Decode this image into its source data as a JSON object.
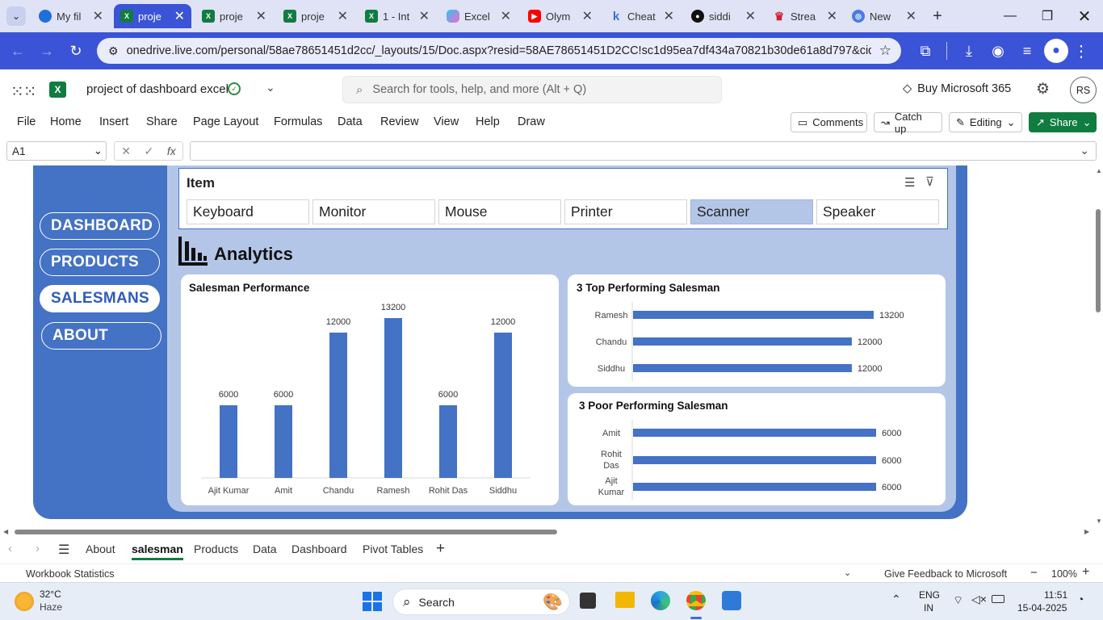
{
  "browser": {
    "tabs": [
      {
        "label": "My fil",
        "icon": "onedrive-icon",
        "active": false
      },
      {
        "label": "proje",
        "icon": "excel-icon",
        "active": true
      },
      {
        "label": "proje",
        "icon": "excel-icon",
        "active": false
      },
      {
        "label": "proje",
        "icon": "excel-icon",
        "active": false
      },
      {
        "label": "1 - Int",
        "icon": "excel-icon",
        "active": false
      },
      {
        "label": "Excel",
        "icon": "copilot-icon",
        "active": false
      },
      {
        "label": "Olym",
        "icon": "youtube-icon",
        "active": false
      },
      {
        "label": "Cheat",
        "icon": "k-icon",
        "active": false
      },
      {
        "label": "siddi",
        "icon": "github-icon",
        "active": false
      },
      {
        "label": "Strea",
        "icon": "utorrent-icon",
        "active": false
      },
      {
        "label": "New",
        "icon": "chrome-icon",
        "active": false
      }
    ],
    "url": "onedrive.live.com/personal/58ae78651451d2cc/_layouts/15/Doc.aspx?resid=58AE78651451D2CC!sc1d95ea7df434a70821b30de61a8d797&cid=58..."
  },
  "excel": {
    "doc_title": "project of dashboard excel",
    "search_placeholder": "Search for tools, help, and more (Alt + Q)",
    "buy_label": "Buy Microsoft 365",
    "avatar": "RS",
    "menus": [
      "File",
      "Home",
      "Insert",
      "Share",
      "Page Layout",
      "Formulas",
      "Data",
      "Review",
      "View",
      "Help",
      "Draw"
    ],
    "comments_label": "Comments",
    "catchup_label": "Catch up",
    "editing_label": "Editing",
    "share_label": "Share",
    "name_box": "A1",
    "fx": "fx"
  },
  "dashboard": {
    "nav": [
      "DASHBOARD",
      "PRODUCTS",
      "SALESMANS",
      "ABOUT"
    ],
    "nav_selected": 2,
    "slicer_title": "Item",
    "slicer_items": [
      "Keyboard",
      "Monitor",
      "Mouse",
      "Printer",
      "Scanner",
      "Speaker"
    ],
    "slicer_selected": 4,
    "analytics_title": "Analytics"
  },
  "chart_data": [
    {
      "type": "bar",
      "title": "Salesman Performance",
      "categories": [
        "Ajit Kumar",
        "Amit",
        "Chandu",
        "Ramesh",
        "Rohit Das",
        "Siddhu"
      ],
      "values": [
        6000,
        6000,
        12000,
        13200,
        6000,
        12000
      ],
      "ylim": [
        0,
        14000
      ],
      "color": "#4472c4"
    },
    {
      "type": "bar",
      "orientation": "horizontal",
      "title": "3 Top Performing Salesman",
      "categories": [
        "Ramesh",
        "Chandu",
        "Siddhu"
      ],
      "values": [
        13200,
        12000,
        12000
      ],
      "xlim": [
        0,
        13200
      ],
      "color": "#4472c4"
    },
    {
      "type": "bar",
      "orientation": "horizontal",
      "title": "3 Poor Performing Salesman",
      "categories": [
        "Amit",
        "Rohit Das",
        "Ajit Kumar"
      ],
      "values": [
        6000,
        6000,
        6000
      ],
      "xlim": [
        0,
        6000
      ],
      "color": "#4472c4"
    }
  ],
  "sheets": {
    "tabs": [
      "About",
      "salesman",
      "Products",
      "Data",
      "Dashboard",
      "Pivot Tables"
    ],
    "active": 1
  },
  "status": {
    "left": "Workbook Statistics",
    "feedback": "Give Feedback to Microsoft",
    "zoom": "100%"
  },
  "taskbar": {
    "weather_temp": "32°C",
    "weather_desc": "Haze",
    "search_label": "Search",
    "lang1": "ENG",
    "lang2": "IN",
    "time": "11:51",
    "date": "15-04-2025"
  }
}
